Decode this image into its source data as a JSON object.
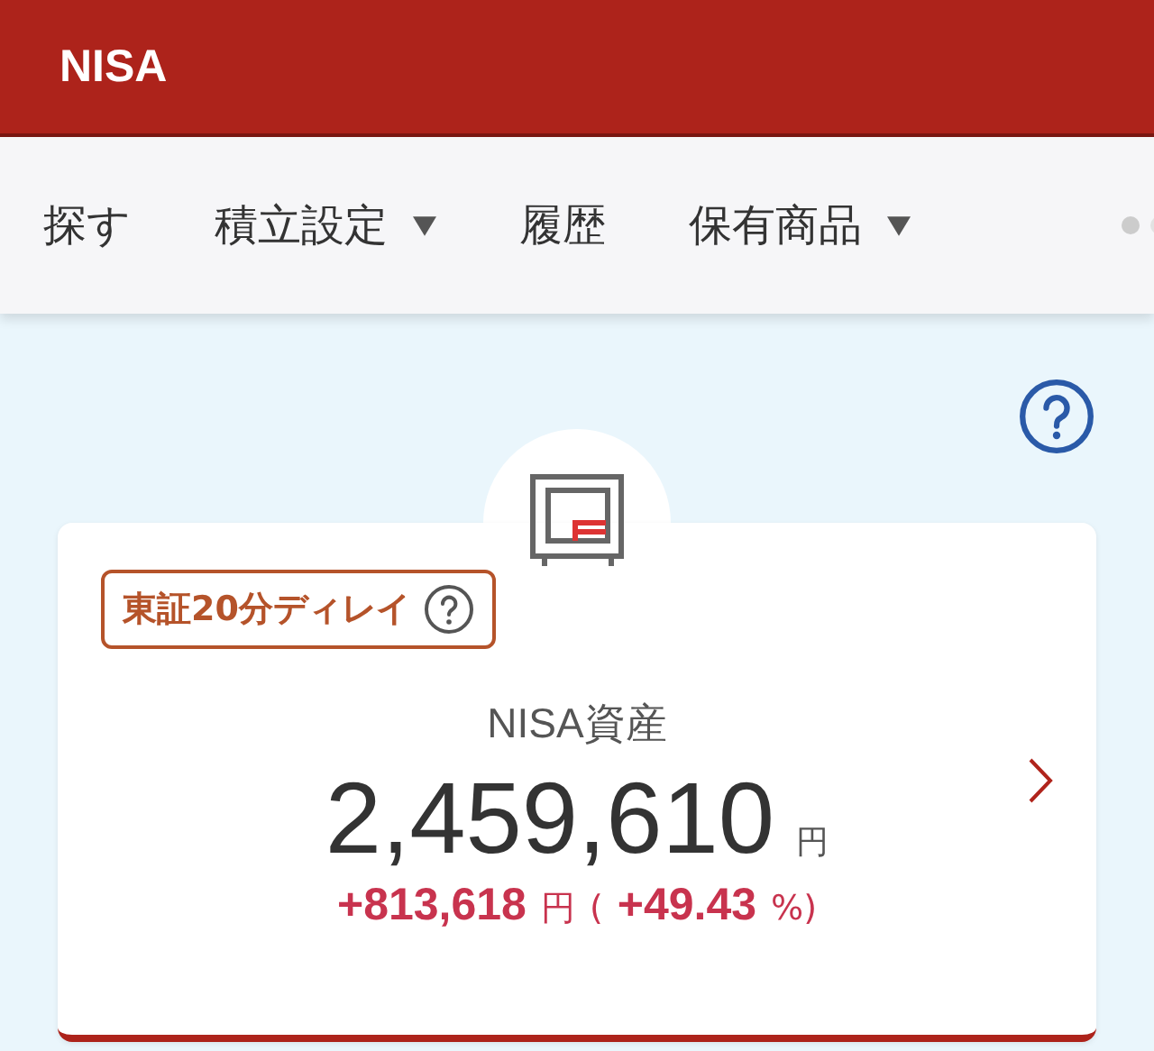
{
  "header": {
    "title": "NISA"
  },
  "nav": {
    "items": [
      {
        "label": "探す",
        "dropdown": false
      },
      {
        "label": "積立設定",
        "dropdown": true
      },
      {
        "label": "履歴",
        "dropdown": false
      },
      {
        "label": "保有商品",
        "dropdown": true
      }
    ]
  },
  "card": {
    "delay_badge": "東証20分ディレイ",
    "title": "NISA資産",
    "amount": "2,459,610",
    "amount_unit": "円",
    "gain": "+813,618",
    "gain_unit": "円",
    "paren_open": "(",
    "gain_percent": "+49.43",
    "percent_close": "%)"
  }
}
